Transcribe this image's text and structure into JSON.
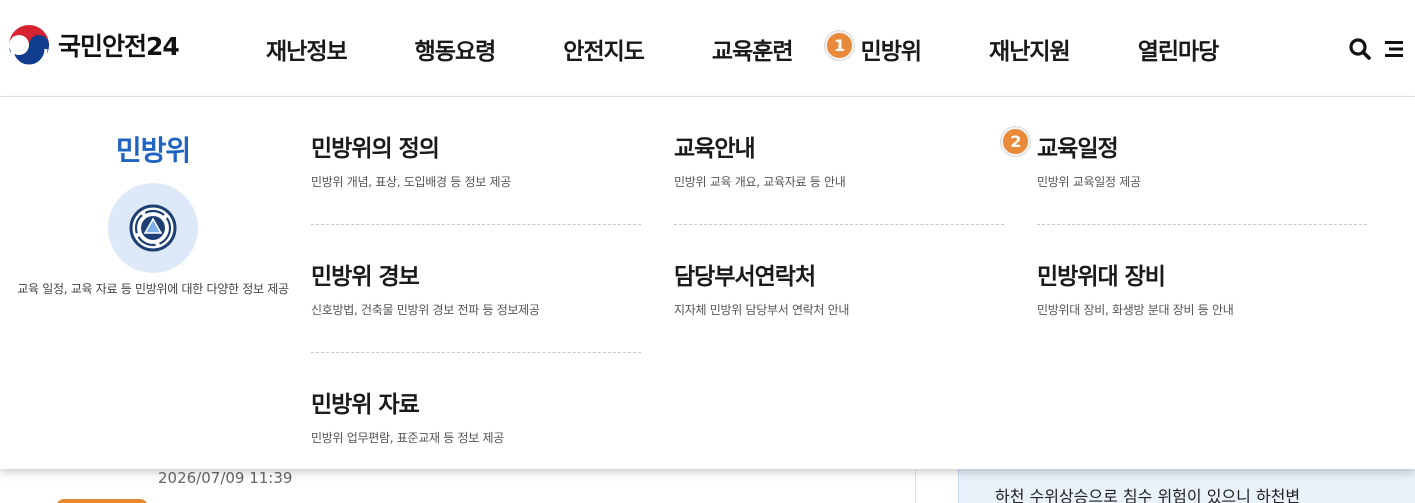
{
  "header": {
    "logo_text": "국민안전24",
    "nav": [
      {
        "label": "재난정보"
      },
      {
        "label": "행동요령"
      },
      {
        "label": "안전지도"
      },
      {
        "label": "교육훈련"
      },
      {
        "label": "민방위",
        "badge": "1"
      },
      {
        "label": "재난지원"
      },
      {
        "label": "열린마당"
      }
    ],
    "search_icon": "search-icon",
    "menu_icon": "hamburger-menu-icon"
  },
  "mega_menu": {
    "title": "민방위",
    "emblem_icon": "civil-defense-emblem-icon",
    "description": "교육 일정, 교육 자료 등 민방위에 대한 다양한 정보 제공",
    "columns": [
      [
        {
          "title": "민방위의 정의",
          "desc": "민방위 개념, 표상, 도입배경 등 정보 제공"
        },
        {
          "title": "민방위 경보",
          "desc": "신호방법, 건축물 민방위 경보 전파 등 정보제공"
        },
        {
          "title": "민방위 자료",
          "desc": "민방위 업무편람, 표준교재 등 정보 제공"
        }
      ],
      [
        {
          "title": "교육안내",
          "desc": "민방위 교육 개요, 교육자료 등 안내"
        },
        {
          "title": "담당부서연락처",
          "desc": "지자체 민방위 담당부서 연락처 안내"
        }
      ],
      [
        {
          "title": "교육일정",
          "desc": "민방위 교육일정 제공",
          "badge": "2"
        },
        {
          "title": "민방위대 장비",
          "desc": "민방위대 장비, 화생방 분대 장비 등 안내"
        }
      ]
    ]
  },
  "background": {
    "date": "2026/07/09 11:39",
    "notice": "하천 수위상승으로 침수 위험이 있으니 하천변"
  },
  "colors": {
    "accent_blue": "#1f64c0",
    "badge_orange": "#e98a3b",
    "emblem_bg": "#dde9f8"
  }
}
